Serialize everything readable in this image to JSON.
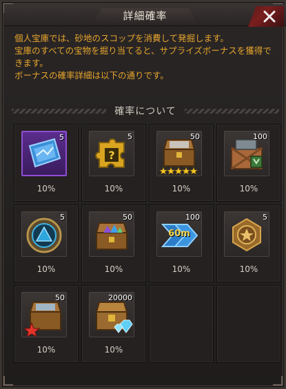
{
  "dialog": {
    "title": "詳細確率"
  },
  "description": [
    "個人宝庫では、砂地のスコップを消費して発掘します。",
    "宝庫のすべての宝物を掘り当てると、サプライズボーナスを獲得できます。",
    "ボーナスの確率詳細は以下の通りです。"
  ],
  "section": {
    "title": "確率について"
  },
  "items": [
    {
      "icon": "blue-map-icon",
      "qty": "5",
      "pct": "10%"
    },
    {
      "icon": "gold-puzzle-icon",
      "qty": "5",
      "pct": "10%"
    },
    {
      "icon": "five-star-chest-icon",
      "qty": "50",
      "pct": "10%"
    },
    {
      "icon": "supply-crate-icon",
      "qty": "100",
      "pct": "10%"
    },
    {
      "icon": "blue-emblem-icon",
      "qty": "5",
      "pct": "10%"
    },
    {
      "icon": "gem-chest-icon",
      "qty": "50",
      "pct": "10%"
    },
    {
      "icon": "speedup-60m-icon",
      "qty": "100",
      "pct": "10%",
      "label": "60m"
    },
    {
      "icon": "bronze-medal-icon",
      "qty": "5",
      "pct": "10%"
    },
    {
      "icon": "red-star-chest-icon",
      "qty": "50",
      "pct": "10%"
    },
    {
      "icon": "diamond-chest-icon",
      "qty": "20000",
      "pct": "10%"
    }
  ],
  "colors": {
    "accent_text": "#e6a52c",
    "close_button": "#7a1e1e",
    "epic_border": "#8f4fd1"
  }
}
